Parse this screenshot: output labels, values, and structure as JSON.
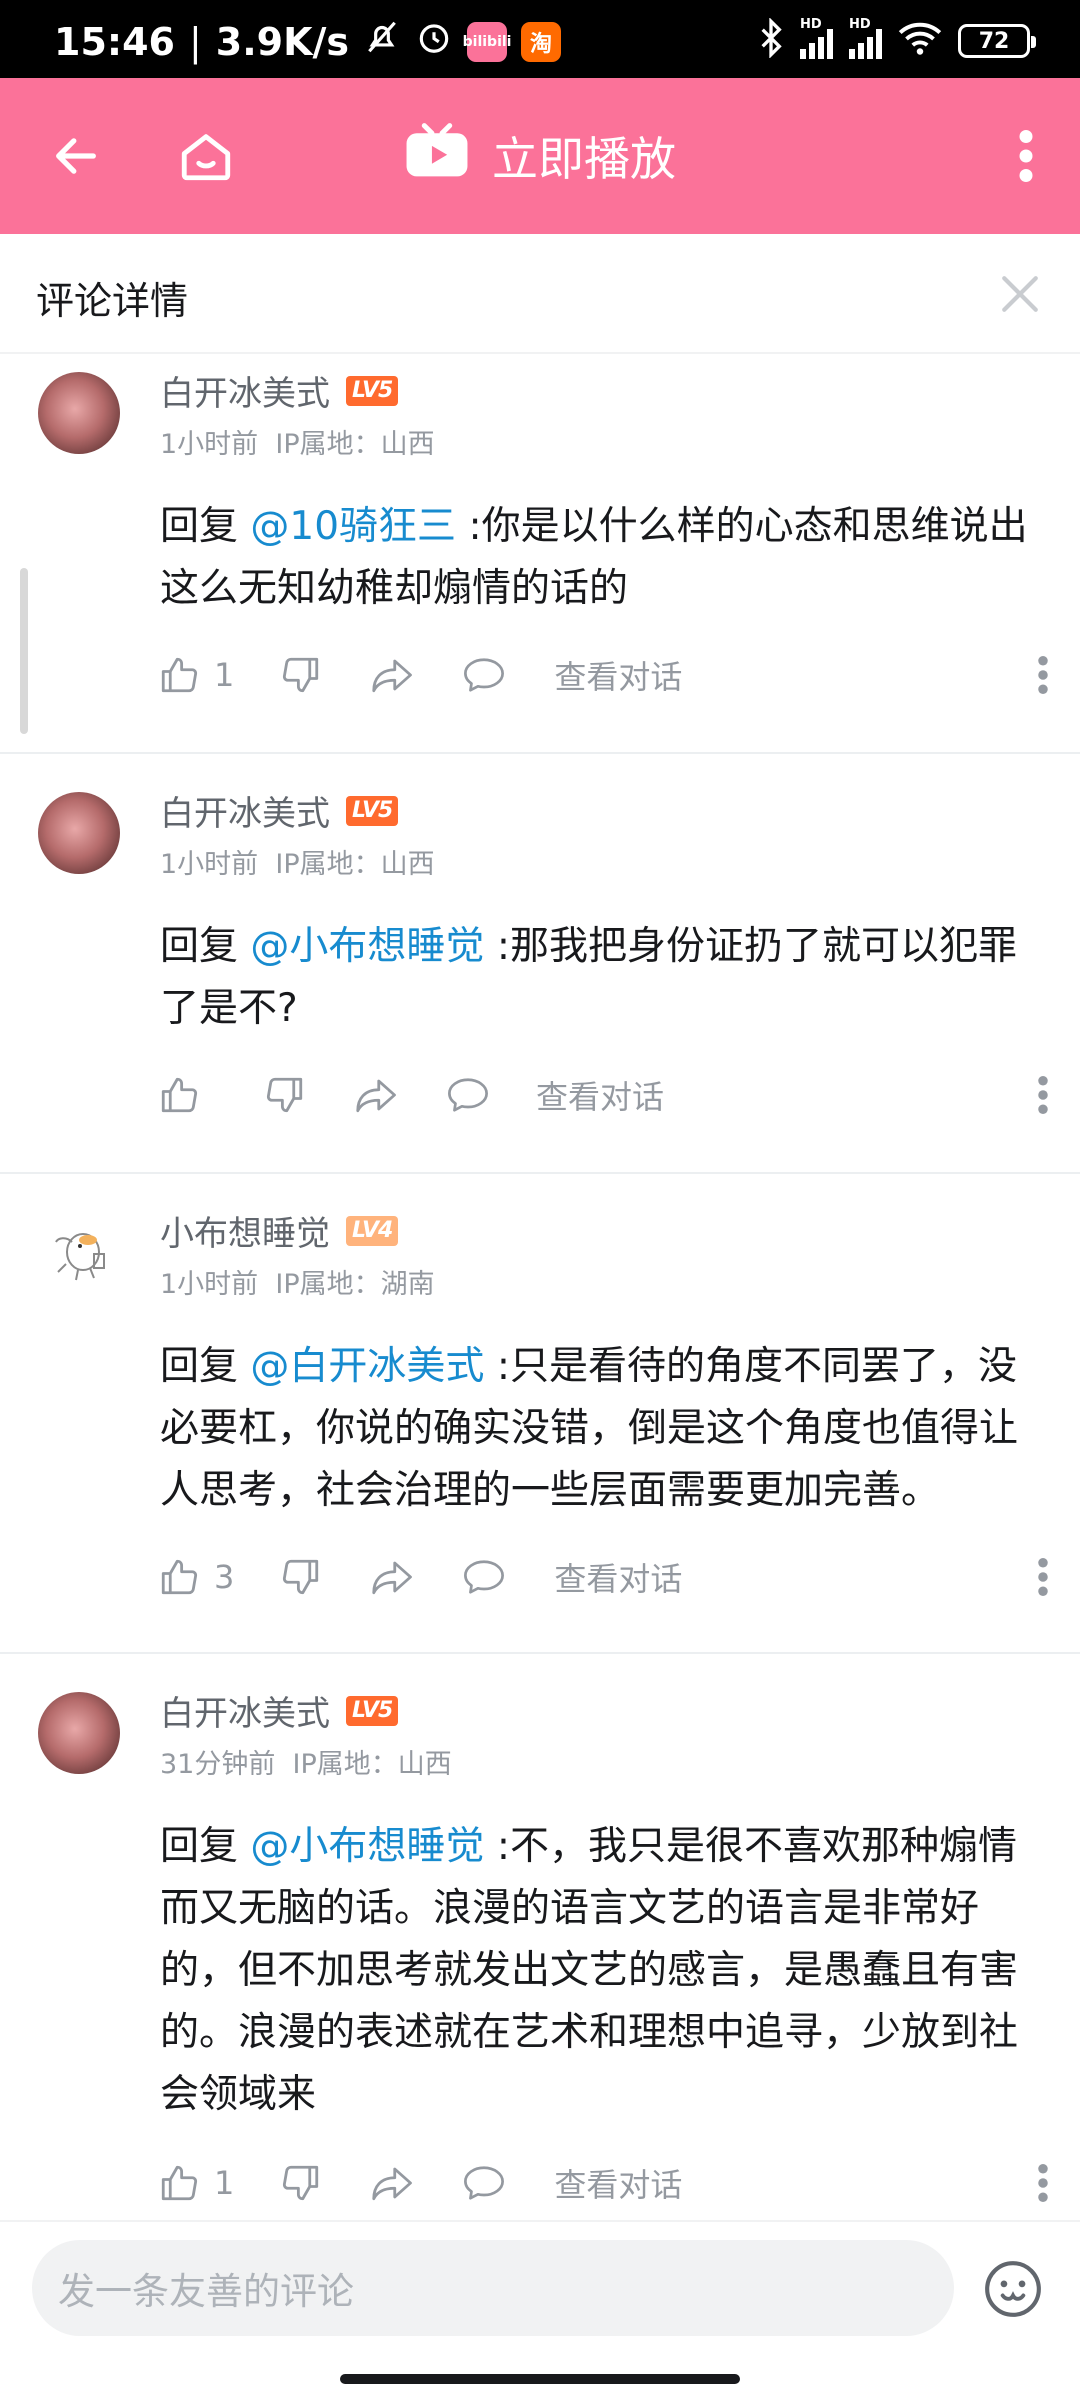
{
  "status_bar": {
    "time": "15:46",
    "speed": "3.9K/s",
    "app_icon_1": "bilibili",
    "app_icon_2": "淘",
    "battery": "72",
    "signal_label": "HD"
  },
  "header": {
    "play_label": "立即播放",
    "accent_color": "#fb7299"
  },
  "sheet": {
    "title": "评论详情"
  },
  "comments": [
    {
      "username": "白开冰美式",
      "level": "LV5",
      "time": "1小时前",
      "ip": "IP属地：山西",
      "reply_prefix": "回复 ",
      "mention": "@10骑狂三",
      "text": " :你是以什么样的心态和思维说出这么无知幼稚却煽情的话的",
      "likes": "1",
      "view_chat": "查看对话"
    },
    {
      "username": "白开冰美式",
      "level": "LV5",
      "time": "1小时前",
      "ip": "IP属地：山西",
      "reply_prefix": "回复 ",
      "mention": "@小布想睡觉",
      "text": " :那我把身份证扔了就可以犯罪了是不?",
      "likes": "",
      "view_chat": "查看对话"
    },
    {
      "username": "小布想睡觉",
      "level": "LV4",
      "time": "1小时前",
      "ip": "IP属地：湖南",
      "reply_prefix": "回复 ",
      "mention": "@白开冰美式",
      "text": " :只是看待的角度不同罢了，没必要杠，你说的确实没错，倒是这个角度也值得让人思考，社会治理的一些层面需要更加完善。",
      "likes": "3",
      "view_chat": "查看对话"
    },
    {
      "username": "白开冰美式",
      "level": "LV5",
      "time": "31分钟前",
      "ip": "IP属地：山西",
      "reply_prefix": "回复 ",
      "mention": "@小布想睡觉",
      "text": " :不，我只是很不喜欢那种煽情而又无脑的话。浪漫的语言文艺的语言是非常好的，但不加思考就发出文艺的感言，是愚蠢且有害的。浪漫的表述就在艺术和理想中追寻，少放到社会领域来",
      "likes": "1",
      "view_chat": "查看对话"
    }
  ],
  "input": {
    "placeholder": "发一条友善的评论"
  },
  "colors": {
    "lv5": "#ff6a2e",
    "lv4": "#ffb37c",
    "mention": "#178bcf"
  }
}
